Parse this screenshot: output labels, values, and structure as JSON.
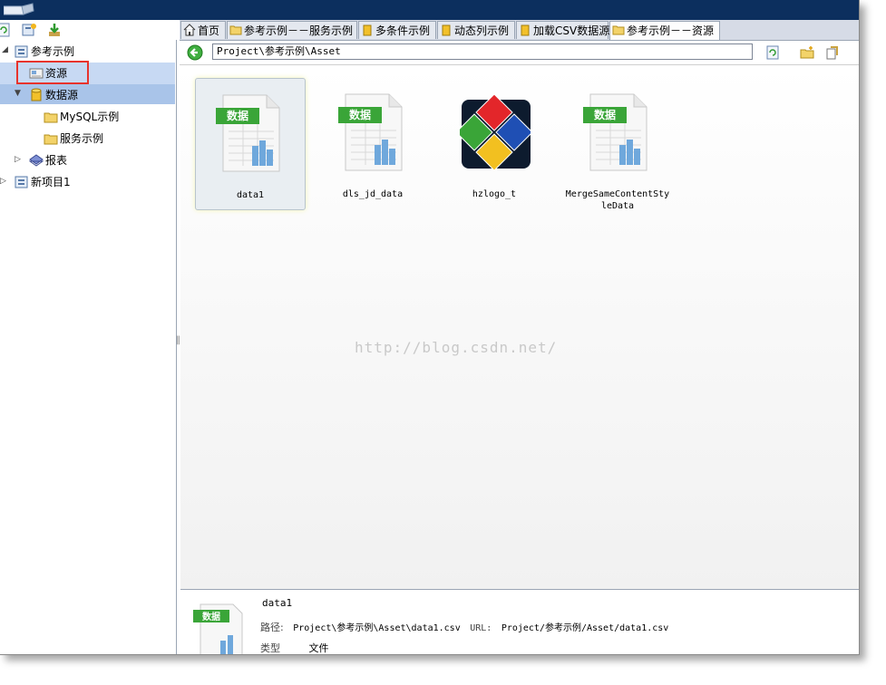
{
  "toolbar_left": {
    "icons": [
      "refresh-icon",
      "new-project-icon",
      "download-icon"
    ]
  },
  "tree": {
    "root": "参考示例",
    "asset": "资源",
    "datasource": "数据源",
    "mysql": "MySQL示例",
    "service": "服务示例",
    "report": "报表",
    "newproject": "新项目1"
  },
  "tabs": [
    {
      "label": "首页",
      "icon": "home-icon"
    },
    {
      "label": "参考示例－－服务示例",
      "icon": "folder-icon"
    },
    {
      "label": "多条件示例",
      "icon": "database-icon"
    },
    {
      "label": "动态列示例",
      "icon": "database-icon"
    },
    {
      "label": "加载CSV数据源",
      "icon": "database-icon"
    },
    {
      "label": "参考示例－－资源",
      "icon": "folder-icon"
    }
  ],
  "path": {
    "value": "Project\\参考示例\\Asset"
  },
  "files": [
    {
      "name": "data1",
      "badge": "数据",
      "kind": "data"
    },
    {
      "name": "dls_jd_data",
      "badge": "数据",
      "kind": "data"
    },
    {
      "name": "hzlogo_t",
      "badge": "",
      "kind": "logo"
    },
    {
      "name": "MergeSameContentStyleData",
      "badge": "数据",
      "kind": "data"
    }
  ],
  "watermark": "http://blog.csdn.net/",
  "details": {
    "name": "data1",
    "badge": "数据",
    "path_label": "路径:",
    "path_value": "Project\\参考示例\\Asset\\data1.csv",
    "url_label": "URL:",
    "url_value": "Project/参考示例/Asset/data1.csv",
    "type_label": "类型",
    "type_value": "文件"
  },
  "colors": {
    "titlebar": "#0c2f5e",
    "selection": "#a9c4e9",
    "badge": "#3aa538",
    "highlight": "#e8332c"
  }
}
